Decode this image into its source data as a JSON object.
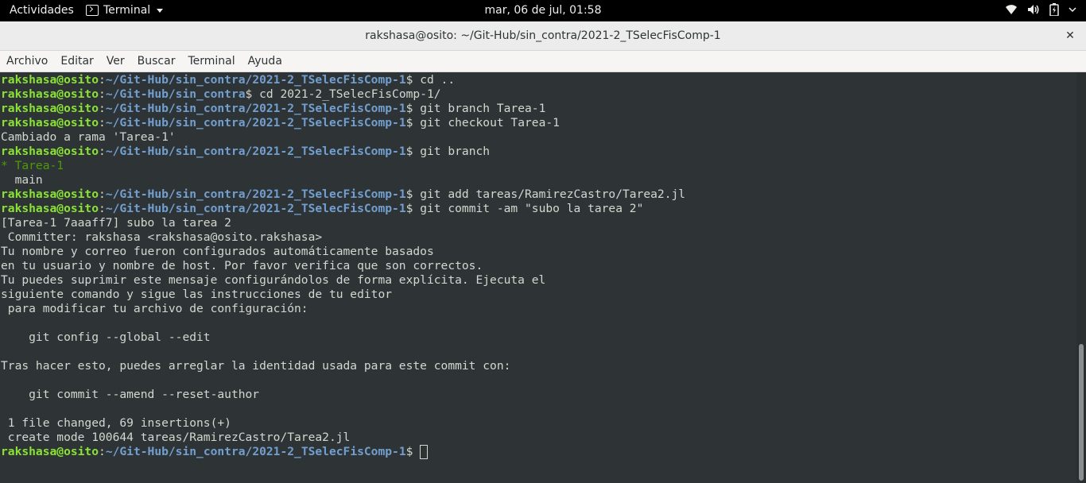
{
  "topbar": {
    "activities": "Actividades",
    "app_name": "Terminal",
    "clock": "mar, 06 de jul, 01:58",
    "tray_icons": [
      "wifi-icon",
      "volume-icon",
      "battery-icon",
      "chevron-down-icon"
    ]
  },
  "window": {
    "title": "rakshasa@osito: ~/Git-Hub/sin_contra/2021-2_TSelecFisComp-1",
    "close": "✕"
  },
  "menu": [
    "Archivo",
    "Editar",
    "Ver",
    "Buscar",
    "Terminal",
    "Ayuda"
  ],
  "terminal": {
    "user_host": "rakshasa@osito",
    "lines": [
      {
        "type": "prompt",
        "path": "~/Git-Hub/sin_contra/2021-2_TSelecFisComp-1",
        "cmd": "cd .."
      },
      {
        "type": "prompt",
        "path": "~/Git-Hub/sin_contra",
        "cmd": "cd 2021-2_TSelecFisComp-1/"
      },
      {
        "type": "prompt",
        "path": "~/Git-Hub/sin_contra/2021-2_TSelecFisComp-1",
        "cmd": "git branch Tarea-1"
      },
      {
        "type": "prompt",
        "path": "~/Git-Hub/sin_contra/2021-2_TSelecFisComp-1",
        "cmd": "git checkout Tarea-1"
      },
      {
        "type": "out",
        "text": "Cambiado a rama 'Tarea-1'"
      },
      {
        "type": "prompt",
        "path": "~/Git-Hub/sin_contra/2021-2_TSelecFisComp-1",
        "cmd": "git branch"
      },
      {
        "type": "branch",
        "text": "* Tarea-1"
      },
      {
        "type": "out",
        "text": "  main"
      },
      {
        "type": "prompt",
        "path": "~/Git-Hub/sin_contra/2021-2_TSelecFisComp-1",
        "cmd": "git add tareas/RamirezCastro/Tarea2.jl"
      },
      {
        "type": "prompt",
        "path": "~/Git-Hub/sin_contra/2021-2_TSelecFisComp-1",
        "cmd": "git commit -am \"subo la tarea 2\""
      },
      {
        "type": "out",
        "text": "[Tarea-1 7aaaff7] subo la tarea 2"
      },
      {
        "type": "out",
        "text": " Committer: rakshasa <rakshasa@osito.rakshasa>"
      },
      {
        "type": "out",
        "text": "Tu nombre y correo fueron configurados automáticamente basados"
      },
      {
        "type": "out",
        "text": "en tu usuario y nombre de host. Por favor verifica que son correctos."
      },
      {
        "type": "out",
        "text": "Tu puedes suprimir este mensaje configurándolos de forma explícita. Ejecuta el"
      },
      {
        "type": "out",
        "text": "siguiente comando y sigue las instrucciones de tu editor"
      },
      {
        "type": "out",
        "text": " para modificar tu archivo de configuración:"
      },
      {
        "type": "out",
        "text": ""
      },
      {
        "type": "out",
        "text": "    git config --global --edit"
      },
      {
        "type": "out",
        "text": ""
      },
      {
        "type": "out",
        "text": "Tras hacer esto, puedes arreglar la identidad usada para este commit con:"
      },
      {
        "type": "out",
        "text": ""
      },
      {
        "type": "out",
        "text": "    git commit --amend --reset-author"
      },
      {
        "type": "out",
        "text": ""
      },
      {
        "type": "out",
        "text": " 1 file changed, 69 insertions(+)"
      },
      {
        "type": "out",
        "text": " create mode 100644 tareas/RamirezCastro/Tarea2.jl"
      },
      {
        "type": "prompt",
        "path": "~/Git-Hub/sin_contra/2021-2_TSelecFisComp-1",
        "cmd": "",
        "cursor": true
      }
    ]
  },
  "colors": {
    "background": "#2e3436",
    "text": "#d3d7cf",
    "user": "#8ae234",
    "path": "#729fcf",
    "branch": "#4e9a06"
  }
}
